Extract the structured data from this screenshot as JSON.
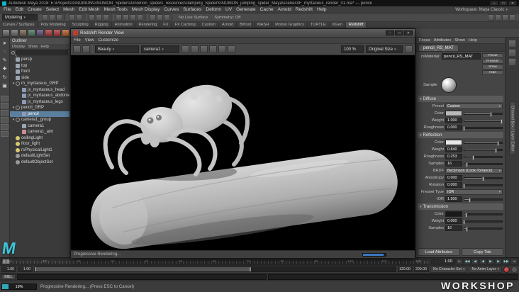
{
  "titlebar": {
    "title": "Autodesk Maya 2018: E:\\Projects\\GNOMON\\GNOMON_Spiders\\Gnomon_spiders_resources\\clamping_Spider\\GNOMON_jumping_spider_Maya\\scenes\\IF_myrtaceus_render_01.ma* --- pencil",
    "window_buttons": [
      "–",
      "□",
      "✕"
    ]
  },
  "menubar": {
    "items": [
      "File",
      "Edit",
      "Create",
      "Select",
      "Mesh",
      "Edit Mesh",
      "Mesh Tools",
      "Mesh Display",
      "Curves",
      "Surfaces",
      "Deform",
      "UV",
      "Generate",
      "Cache",
      "Arnold",
      "Redshift",
      "Help"
    ],
    "workspace_label": "Workspace:",
    "workspace_value": "Maya Classic"
  },
  "statusline": {
    "menuset": "Modeling",
    "live_surface": "No Live Surface",
    "symmetry": "Symmetry: Off",
    "icon_groups": [
      [
        "new-scene-icon",
        "open-scene-icon",
        "save-scene-icon"
      ],
      [
        "undo-icon",
        "redo-icon"
      ],
      [
        "select-hierarchy-icon",
        "select-object-icon",
        "select-component-icon"
      ],
      [
        "snap-grid-icon",
        "snap-curve-icon",
        "snap-point-icon",
        "snap-plane-icon"
      ],
      [
        "render-frame-icon",
        "ipr-render-icon",
        "render-settings-icon"
      ]
    ],
    "right_icons": [
      "modeling-toolkit-icon",
      "attribute-editor-icon",
      "tool-settings-icon",
      "channel-box-icon"
    ]
  },
  "shelf": {
    "active_tab": "Redshift",
    "tabs": [
      "Curves / Surfaces",
      "Poly Modeling",
      "Sculpting",
      "Rigging",
      "Animation",
      "Rendering",
      "FX",
      "FX Caching",
      "Custom",
      "Arnold",
      "Bifrost",
      "MASH",
      "Motion Graphics",
      "TURTLE",
      "XGen",
      "Redshift"
    ],
    "icons": [
      "#6d6d6d",
      "#6d6d6d",
      "#77624f",
      "#4f7762",
      "#624f77",
      "#b03a3a",
      "#b03a3a",
      "#c2622a",
      "#2a62c2",
      "#35a06a",
      "#8a8a8a",
      "#6d6d6d",
      "#b03a3a",
      "#b03a3a",
      "#5a5a5a",
      "#6d6d6d",
      "#7a7a7a",
      "#666666"
    ]
  },
  "toolbox": {
    "tools": [
      {
        "name": "select-tool",
        "glyph": "➤"
      },
      {
        "name": "lasso-select-tool",
        "glyph": "◌"
      },
      {
        "name": "paint-select-tool",
        "glyph": "✎"
      },
      {
        "name": "move-tool",
        "glyph": "✚"
      },
      {
        "name": "rotate-tool",
        "glyph": "↻"
      },
      {
        "name": "scale-tool",
        "glyph": "▣"
      }
    ],
    "layouts": [
      "single-pane-layout",
      "four-pane-layout",
      "persp-outliner-layout",
      "persp-graph-layout",
      "hypershade-layout",
      "uv-editor-layout"
    ]
  },
  "outliner": {
    "title": "Outliner",
    "menus": [
      "Display",
      "Show",
      "Help"
    ],
    "expander_open": "▾",
    "expander_closed": "▸",
    "items": [
      {
        "label": "persp",
        "depth": 0,
        "icon": "camera"
      },
      {
        "label": "top",
        "depth": 0,
        "icon": "camera"
      },
      {
        "label": "front",
        "depth": 0,
        "icon": "camera"
      },
      {
        "label": "side",
        "depth": 0,
        "icon": "camera"
      },
      {
        "label": "m_myrtaceus_GRP",
        "depth": 0,
        "icon": "group",
        "expanded": true
      },
      {
        "label": "jx_myrtaceus_head",
        "depth": 1,
        "icon": "mesh"
      },
      {
        "label": "jx_myrtaceus_abdomen",
        "depth": 1,
        "icon": "mesh"
      },
      {
        "label": "jx_myrtaceus_legs",
        "depth": 1,
        "icon": "mesh"
      },
      {
        "label": "pencil_GRP",
        "depth": 0,
        "icon": "group",
        "expanded": true
      },
      {
        "label": "pencil",
        "depth": 1,
        "icon": "mesh",
        "selected": true
      },
      {
        "label": "camera1_group",
        "depth": 0,
        "icon": "group",
        "expanded": true
      },
      {
        "label": "camera1",
        "depth": 1,
        "icon": "camera"
      },
      {
        "label": "camera1_aim",
        "depth": 1,
        "icon": "locator"
      },
      {
        "label": "ceilingLight",
        "depth": 0,
        "icon": "light"
      },
      {
        "label": "floor_light",
        "depth": 0,
        "icon": "light"
      },
      {
        "label": "rsPhysicalLight1",
        "depth": 0,
        "icon": "light"
      },
      {
        "label": "defaultLightSet",
        "depth": 0,
        "icon": "set"
      },
      {
        "label": "defaultObjectSet",
        "depth": 0,
        "icon": "set"
      }
    ]
  },
  "renderview": {
    "title": "Redshift Render View",
    "window_buttons": [
      "–",
      "□",
      "✕"
    ],
    "menus": [
      "File",
      "View",
      "Customize"
    ],
    "toolbar": {
      "left_icons": [
        "save-image-icon",
        "load-image-icon"
      ],
      "aov_value": "Beauty",
      "camera_value": "camera1",
      "mid_icons": [
        "start-ipr-icon",
        "stop-render-icon",
        "region-render-icon",
        "snapshot-icon",
        "compare-ab-icon",
        "dock-icon"
      ],
      "zoom_value": "100 %",
      "size_value": "Original Size",
      "right_icons": [
        "settings-gear-icon"
      ]
    },
    "status_text": "Progressive Rendering...",
    "progress_fraction": 0.9
  },
  "attribute_editor": {
    "menus": [
      "Focus",
      "Attributes",
      "Show",
      "Help"
    ],
    "tab": "pencil_RS_MAT",
    "material_label": "rsMaterial:",
    "material_name": "pencil_RS_MAT",
    "side_buttons": [
      "Focus",
      "Presets*",
      "Show",
      "Hide"
    ],
    "sample_label": "Sample",
    "sections": [
      {
        "title": "Diffuse",
        "rows": [
          {
            "kind": "dropdown",
            "label": "Preset",
            "value": "Custom"
          },
          {
            "kind": "color",
            "label": "Color",
            "swatch": "#b9b9b9",
            "fill": 0.72
          },
          {
            "kind": "slider",
            "label": "Weight",
            "value": "1.000",
            "fill": 1
          },
          {
            "kind": "slider",
            "label": "Roughness",
            "value": "0.000",
            "fill": 0
          }
        ]
      },
      {
        "title": "Reflection",
        "rows": [
          {
            "kind": "color",
            "label": "Color",
            "swatch": "#e8e8e8",
            "fill": 0.9
          },
          {
            "kind": "slider",
            "label": "Weight",
            "value": "0.840",
            "fill": 0.84
          },
          {
            "kind": "slider",
            "label": "Roughness",
            "value": "0.253",
            "fill": 0.25
          },
          {
            "kind": "slider",
            "label": "Samples",
            "value": "16",
            "fill": 0.08
          },
          {
            "kind": "dropdown",
            "label": "BRDF",
            "value": "Beckmann (Cook-Torrance)"
          },
          {
            "kind": "slider",
            "label": "Anisotropy",
            "value": "0.000",
            "fill": 0.5
          },
          {
            "kind": "slider",
            "label": "Rotation",
            "value": "0.000",
            "fill": 0
          },
          {
            "kind": "dropdown",
            "label": "Fresnel Type",
            "value": "IOR"
          },
          {
            "kind": "slider",
            "label": "IOR",
            "value": "1.500",
            "fill": 0.15
          }
        ]
      },
      {
        "title": "Transmission",
        "rows": [
          {
            "kind": "color",
            "label": "Color",
            "swatch": "#1a1a1a",
            "fill": 0.05
          },
          {
            "kind": "slider",
            "label": "Weight",
            "value": "0.000",
            "fill": 0
          },
          {
            "kind": "slider",
            "label": "Samples",
            "value": "16",
            "fill": 0.08
          }
        ]
      }
    ],
    "footer_buttons": [
      "Load Attributes",
      "Copy Tab"
    ]
  },
  "right_strip": {
    "vertical_tab": "Channel Box / Layer Editor",
    "icons": [
      "attribute-editor-icon",
      "tool-settings-icon",
      "channel-box-icon"
    ]
  },
  "timeslider": {
    "tick_labels": [
      "1",
      "10",
      "20",
      "30",
      "40",
      "50",
      "60",
      "70",
      "80",
      "90",
      "100",
      "110",
      "120"
    ],
    "current_frame": "1",
    "current_time": "1.00",
    "playback": [
      {
        "name": "go-to-start-icon",
        "glyph": "⇤"
      },
      {
        "name": "step-back-frame-icon",
        "glyph": "◀◀"
      },
      {
        "name": "step-back-key-icon",
        "glyph": "◀"
      },
      {
        "name": "play-backwards-icon",
        "glyph": "◀"
      },
      {
        "name": "play-forwards-icon",
        "glyph": "▶"
      },
      {
        "name": "step-forward-key-icon",
        "glyph": "▶"
      },
      {
        "name": "step-forward-frame-icon",
        "glyph": "▶▶"
      },
      {
        "name": "go-to-end-icon",
        "glyph": "⇥"
      }
    ]
  },
  "rangeslider": {
    "start_fields": [
      "1.00",
      "1.00"
    ],
    "end_fields": [
      "120.00",
      "200.00"
    ],
    "character_set": "No Character Set",
    "anim_layer": "No Anim Layer"
  },
  "commandline": {
    "label": "MEL"
  },
  "helpline": {
    "progress": "19%",
    "text": "Progressive Rendering...  (Press ESC to Cancel)"
  },
  "overlays": {
    "logo_m": "M",
    "logo_workshop": "WORKSHOP"
  }
}
